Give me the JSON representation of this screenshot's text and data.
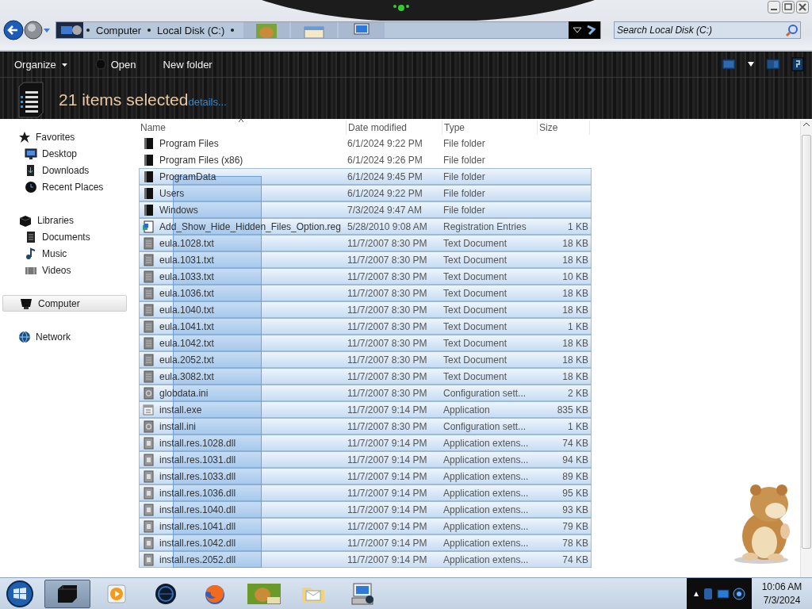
{
  "address_bar": {
    "crumbs": [
      "Computer",
      "Local Disk (C:)"
    ]
  },
  "search": {
    "placeholder": "Search Local Disk (C:)"
  },
  "toolbar": {
    "items": [
      {
        "label": "Organize",
        "kind": "menu"
      },
      {
        "label": "Open",
        "kind": "icon"
      },
      {
        "label": "New folder",
        "kind": "plain"
      }
    ]
  },
  "details": {
    "title": "21 items selected",
    "link": "details..."
  },
  "sidebar": {
    "groups": [
      {
        "label": "Favorites",
        "kind": "favorites",
        "selected": false,
        "children": [
          {
            "label": "Desktop",
            "kind": "desktop",
            "selected": false
          },
          {
            "label": "Downloads",
            "kind": "downloads",
            "selected": false
          },
          {
            "label": "Recent Places",
            "kind": "recent",
            "selected": false
          }
        ]
      },
      {
        "label": "Libraries",
        "kind": "libraries",
        "selected": false,
        "children": [
          {
            "label": "Documents",
            "kind": "documents",
            "selected": false
          },
          {
            "label": "Music",
            "kind": "music",
            "selected": false
          },
          {
            "label": "Videos",
            "kind": "videos",
            "selected": false
          }
        ]
      },
      {
        "label": "Computer",
        "kind": "computer",
        "selected": true
      },
      {
        "label": "Network",
        "kind": "network",
        "selected": false
      }
    ]
  },
  "table": {
    "columns": [
      {
        "label": "Name",
        "sorted": true
      },
      {
        "label": "Date modified",
        "sorted": false
      },
      {
        "label": "Type",
        "sorted": false
      },
      {
        "label": "Size",
        "sorted": false
      }
    ],
    "rows": [
      {
        "name": "Program Files",
        "date": "6/1/2024 9:22 PM",
        "type": "File folder",
        "kind": "folder",
        "selected": false
      },
      {
        "name": "Program Files (x86)",
        "date": "6/1/2024 9:26 PM",
        "type": "File folder",
        "kind": "folder",
        "selected": false
      },
      {
        "name": "ProgramData",
        "date": "6/1/2024 9:45 PM",
        "type": "File folder",
        "kind": "folder",
        "selected": true
      },
      {
        "name": "Users",
        "date": "6/1/2024 9:22 PM",
        "type": "File folder",
        "kind": "folder",
        "selected": true
      },
      {
        "name": "Windows",
        "date": "7/3/2024 9:47 AM",
        "type": "File folder",
        "kind": "folder",
        "selected": true
      },
      {
        "name": "Add_Show_Hide_Hidden_Files_Option.reg",
        "date": "5/28/2010 9:08 AM",
        "type": "Registration Entries",
        "size": "1 KB",
        "kind": "reg",
        "selected": true
      },
      {
        "name": "eula.1028.txt",
        "date": "11/7/2007 8:30 PM",
        "type": "Text Document",
        "size": "18 KB",
        "kind": "txt",
        "selected": true
      },
      {
        "name": "eula.1031.txt",
        "date": "11/7/2007 8:30 PM",
        "type": "Text Document",
        "size": "18 KB",
        "kind": "txt",
        "selected": true
      },
      {
        "name": "eula.1033.txt",
        "date": "11/7/2007 8:30 PM",
        "type": "Text Document",
        "size": "10 KB",
        "kind": "txt",
        "selected": true
      },
      {
        "name": "eula.1036.txt",
        "date": "11/7/2007 8:30 PM",
        "type": "Text Document",
        "size": "18 KB",
        "kind": "txt",
        "selected": true
      },
      {
        "name": "eula.1040.txt",
        "date": "11/7/2007 8:30 PM",
        "type": "Text Document",
        "size": "18 KB",
        "kind": "txt",
        "selected": true
      },
      {
        "name": "eula.1041.txt",
        "date": "11/7/2007 8:30 PM",
        "type": "Text Document",
        "size": "1 KB",
        "kind": "txt",
        "selected": true
      },
      {
        "name": "eula.1042.txt",
        "date": "11/7/2007 8:30 PM",
        "type": "Text Document",
        "size": "18 KB",
        "kind": "txt",
        "selected": true
      },
      {
        "name": "eula.2052.txt",
        "date": "11/7/2007 8:30 PM",
        "type": "Text Document",
        "size": "18 KB",
        "kind": "txt",
        "selected": true
      },
      {
        "name": "eula.3082.txt",
        "date": "11/7/2007 8:30 PM",
        "type": "Text Document",
        "size": "18 KB",
        "kind": "txt",
        "selected": true
      },
      {
        "name": "globdata.ini",
        "date": "11/7/2007 8:30 PM",
        "type": "Configuration sett...",
        "size": "2 KB",
        "kind": "ini",
        "selected": true
      },
      {
        "name": "install.exe",
        "date": "11/7/2007 9:14 PM",
        "type": "Application",
        "size": "835 KB",
        "kind": "exe",
        "selected": true
      },
      {
        "name": "install.ini",
        "date": "11/7/2007 8:30 PM",
        "type": "Configuration sett...",
        "size": "1 KB",
        "kind": "ini",
        "selected": true
      },
      {
        "name": "install.res.1028.dll",
        "date": "11/7/2007 9:14 PM",
        "type": "Application extens...",
        "size": "74 KB",
        "kind": "dll",
        "selected": true
      },
      {
        "name": "install.res.1031.dll",
        "date": "11/7/2007 9:14 PM",
        "type": "Application extens...",
        "size": "94 KB",
        "kind": "dll",
        "selected": true
      },
      {
        "name": "install.res.1033.dll",
        "date": "11/7/2007 9:14 PM",
        "type": "Application extens...",
        "size": "89 KB",
        "kind": "dll",
        "selected": true
      },
      {
        "name": "install.res.1036.dll",
        "date": "11/7/2007 9:14 PM",
        "type": "Application extens...",
        "size": "95 KB",
        "kind": "dll",
        "selected": true
      },
      {
        "name": "install.res.1040.dll",
        "date": "11/7/2007 9:14 PM",
        "type": "Application extens...",
        "size": "93 KB",
        "kind": "dll",
        "selected": true
      },
      {
        "name": "install.res.1041.dll",
        "date": "11/7/2007 9:14 PM",
        "type": "Application extens...",
        "size": "79 KB",
        "kind": "dll",
        "selected": true
      },
      {
        "name": "install.res.1042.dll",
        "date": "11/7/2007 9:14 PM",
        "type": "Application extens...",
        "size": "78 KB",
        "kind": "dll",
        "selected": true
      },
      {
        "name": "install.res.2052.dll",
        "date": "11/7/2007 9:14 PM",
        "type": "Application extens...",
        "size": "74 KB",
        "kind": "dll",
        "selected": true
      }
    ]
  },
  "taskbar": {
    "buttons": [
      {
        "kind": "drive",
        "selected": true
      },
      {
        "kind": "media",
        "selected": false
      },
      {
        "kind": "globe",
        "selected": false
      },
      {
        "kind": "browser",
        "selected": false
      },
      {
        "kind": "pet",
        "selected": false
      },
      {
        "kind": "folder",
        "selected": false
      },
      {
        "kind": "computer",
        "selected": false
      }
    ],
    "clock": {
      "time": "10:06 AM",
      "date": "7/3/2024"
    }
  }
}
